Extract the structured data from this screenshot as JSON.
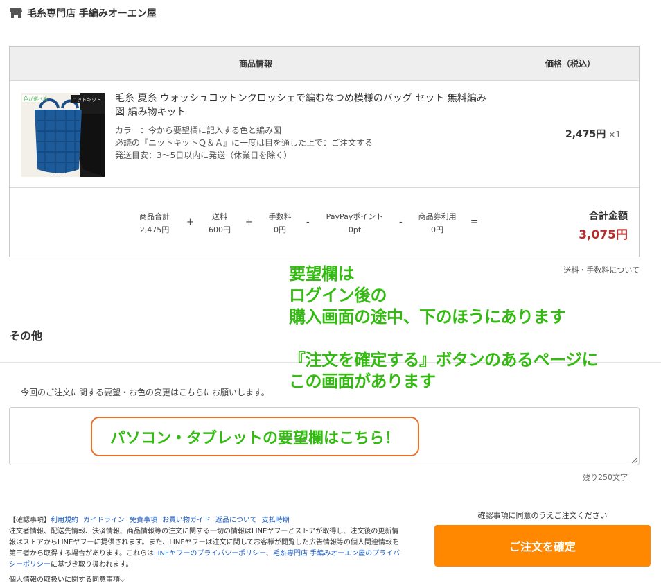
{
  "store": {
    "name": "毛糸専門店 手編みオーエン屋",
    "icon": "shop-icon"
  },
  "table": {
    "headers": {
      "product": "商品情報",
      "price": "価格（税込）"
    },
    "item": {
      "title": "毛糸 夏糸 ウォッシュコットンクロッシェで編むなつめ模様のバッグ セット 無料編み図 編み物キット",
      "attributes": [
        "カラー：今から要望欄に記入する色と編み図",
        "必読の『ニットキットＱ＆Ａ』に一度は目を通した上で：ご注文する",
        "発送目安：3〜5日以内に発送（休業日を除く）"
      ],
      "price": "2,475円",
      "quantity": "×1",
      "thumb_labels": [
        "色が選べる",
        "ニットキット"
      ]
    },
    "totals": {
      "items": [
        {
          "label": "商品合計",
          "value": "2,475円"
        },
        {
          "label": "送料",
          "value": "600円"
        },
        {
          "label": "手数料",
          "value": "0円"
        },
        {
          "label": "PayPayポイント",
          "value": "0pt"
        },
        {
          "label": "商品券利用",
          "value": "0円"
        }
      ],
      "operators": [
        "+",
        "+",
        "-",
        "-",
        "="
      ],
      "grand_label": "合計金額",
      "grand_value": "3,075円"
    },
    "shipping_link": "送料・手数料について"
  },
  "other": {
    "title": "その他",
    "request_label": "今回のご注文に関する要望・お色の変更はこちらにお願いします。",
    "request_value": "",
    "char_count": "残り250文字"
  },
  "overlay": {
    "lines": [
      "要望欄は",
      "ログイン後の",
      "購入画面の途中、下のほうにあります",
      "",
      "『注文を確定する』ボタンのあるページに",
      "この画面があります"
    ],
    "callout": "パソコン・タブレットの要望欄はこちら！",
    "text_color": "#33bb11",
    "callout_border": "#e8702a"
  },
  "footer": {
    "links_prefix": "【確認事項】",
    "links": [
      "利用規約",
      "ガイドライン",
      "免責事項",
      "お買い物ガイド",
      "返品について",
      "支払時期"
    ],
    "notice_text": "注文者情報、配送先情報、決済情報、商品情報等の注文に関する一切の情報はLINEヤフーとストアが取得し、注文後の更新情報はストアからLINEヤフーに提供されます。また、LINEヤフーは注文に関してお客様が閲覧した広告情報等の個人関連情報を第三者から取得する場合があります。これらは",
    "policy_link_1": "LINEヤフーのプライバシーポリシー",
    "policy_sep": "、",
    "policy_link_2": "毛糸専門店 手編みオーエン屋のプライバシーポリシー",
    "policy_suffix": "に基づき取り扱われます。",
    "consent_toggle": "個人情報の取扱いに関する同意事項",
    "confirm_note": "確認事項に同意のうえご注文ください",
    "confirm_button": "ご注文を確定"
  },
  "colors": {
    "accent": "#ff8800",
    "price_red": "#b52e2e",
    "link": "#1a5cc7"
  }
}
